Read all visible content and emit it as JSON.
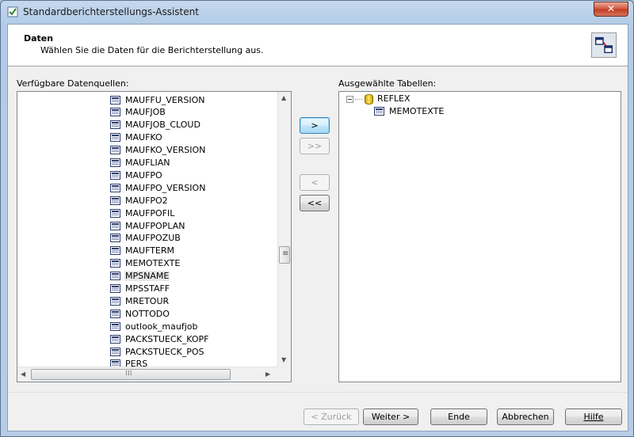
{
  "window": {
    "title": "Standardberichterstellungs-Assistent",
    "close_label": "✕"
  },
  "header": {
    "title": "Daten",
    "subtitle": "Wählen Sie die Daten für die Berichterstellung aus."
  },
  "left_panel": {
    "label": "Verfügbare Datenquellen:",
    "items": [
      "MAUFFU_VERSION",
      "MAUFJOB",
      "MAUFJOB_CLOUD",
      "MAUFKO",
      "MAUFKO_VERSION",
      "MAUFLIAN",
      "MAUFPO",
      "MAUFPO_VERSION",
      "MAUFPO2",
      "MAUFPOFIL",
      "MAUFPOPLAN",
      "MAUFPOZUB",
      "MAUFTERM",
      "MEMOTEXTE",
      "MPSNAME",
      "MPSSTAFF",
      "MRETOUR",
      "NOTTODO",
      "outlook_maufjob",
      "PACKSTUECK_KOPF",
      "PACKSTUECK_POS",
      "PERS"
    ],
    "selected_item": "MPSNAME"
  },
  "right_panel": {
    "label": "Ausgewählte Tabellen:",
    "root": "REFLEX",
    "children": [
      "MEMOTEXTE"
    ]
  },
  "transfer_buttons": {
    "add": ">",
    "add_all": ">>",
    "remove": "<",
    "remove_all": "<<"
  },
  "footer": {
    "back": "< Zurück",
    "next": "Weiter >",
    "finish": "Ende",
    "cancel": "Abbrechen",
    "help": "Hilfe"
  },
  "icons": {
    "title": "wizard-icon",
    "header": "table-link-icon",
    "table": "table-icon",
    "database": "database-icon"
  }
}
